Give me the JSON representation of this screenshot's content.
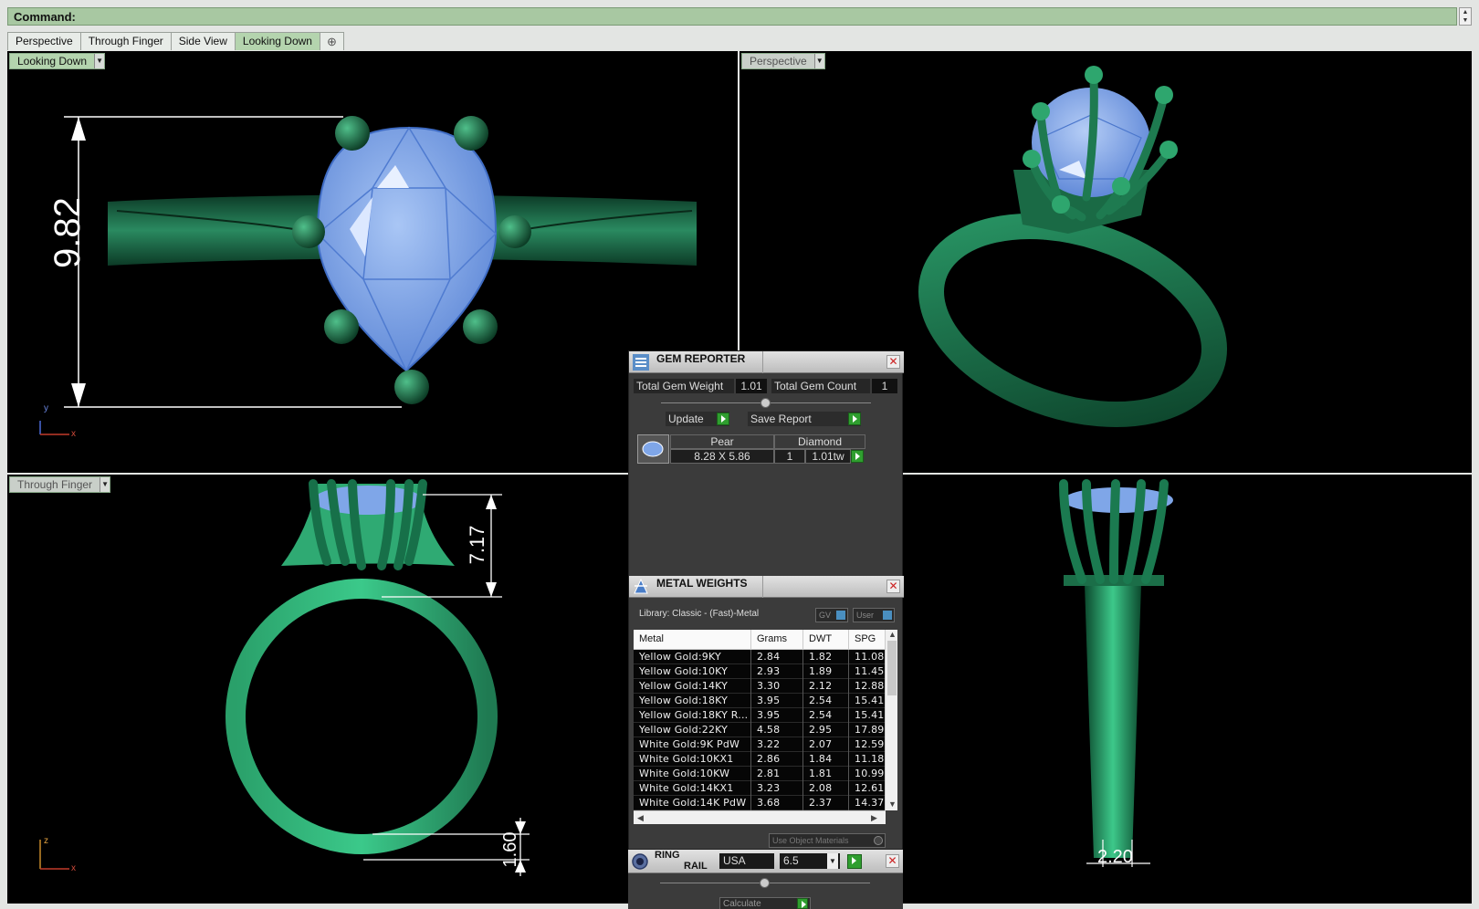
{
  "command": {
    "label": "Command:"
  },
  "tabs": [
    "Perspective",
    "Through Finger",
    "Side View",
    "Looking Down"
  ],
  "tab_add_icon": "plus-icon",
  "viewports": {
    "top_left": {
      "label": "Looking Down",
      "dimension": "9.82",
      "axes": [
        "y",
        "x"
      ]
    },
    "top_right": {
      "label": "Perspective"
    },
    "bottom_left": {
      "label": "Through Finger",
      "dimension_top": "7.17",
      "dimension_bottom": "1.60",
      "axes": [
        "z",
        "x"
      ]
    },
    "bottom_right": {
      "dimension": "2.20"
    }
  },
  "gem_reporter": {
    "title": "GEM REPORTER",
    "total_weight_label": "Total Gem Weight",
    "total_weight_value": "1.01",
    "total_count_label": "Total Gem Count",
    "total_count_value": "1",
    "update_label": "Update",
    "save_report_label": "Save Report",
    "gem": {
      "shape": "Pear",
      "type": "Diamond",
      "size": "8.28 X 5.86",
      "qty": "1",
      "weight": "1.01tw"
    }
  },
  "metal_weights": {
    "title": "METAL WEIGHTS",
    "library": "Library: Classic - (Fast)-Metal",
    "toggle_gv": "GV",
    "toggle_user": "User",
    "columns": [
      "Metal",
      "Grams",
      "DWT",
      "SPG"
    ],
    "rows": [
      [
        "Yellow Gold:9KY",
        "2.84",
        "1.82",
        "11.08"
      ],
      [
        "Yellow Gold:10KY",
        "2.93",
        "1.89",
        "11.45"
      ],
      [
        "Yellow Gold:14KY",
        "3.30",
        "2.12",
        "12.88"
      ],
      [
        "Yellow Gold:18KY",
        "3.95",
        "2.54",
        "15.41"
      ],
      [
        "Yellow Gold:18KY R...",
        "3.95",
        "2.54",
        "15.41"
      ],
      [
        "Yellow Gold:22KY",
        "4.58",
        "2.95",
        "17.89"
      ],
      [
        "White Gold:9K PdW",
        "3.22",
        "2.07",
        "12.59"
      ],
      [
        "White Gold:10KX1",
        "2.86",
        "1.84",
        "11.18"
      ],
      [
        "White Gold:10KW",
        "2.81",
        "1.81",
        "10.99"
      ],
      [
        "White Gold:14KX1",
        "3.23",
        "2.08",
        "12.61"
      ],
      [
        "White Gold:14K PdW",
        "3.68",
        "2.37",
        "14.37"
      ]
    ],
    "use_object_materials": "Use Object Materials"
  },
  "ring_rail": {
    "title_line1": "RING",
    "title_line2": "RAIL",
    "standard": "USA",
    "size": "6.5",
    "calculate_label": "Calculate"
  },
  "colors": {
    "metal": "#1f7a52",
    "gem": "#7fa6e8",
    "accent": "#2f9e2f",
    "title_bar": "#a8c8a2"
  }
}
